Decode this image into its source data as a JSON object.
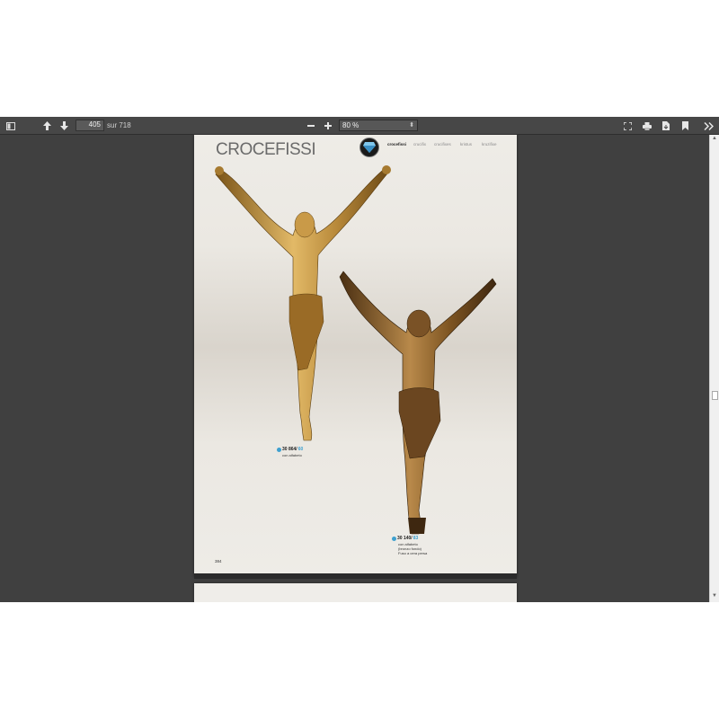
{
  "toolbar": {
    "page_number": "405",
    "page_count": "sur 718",
    "zoom_value": "80 %",
    "icons": [
      "sidebar-toggle-icon",
      "arrow-up-icon",
      "arrow-down-icon",
      "zoom-out-icon",
      "zoom-in-icon",
      "fullscreen-icon",
      "print-icon",
      "download-icon",
      "bookmark-icon",
      "double-chevron-right-icon"
    ]
  },
  "document_page": {
    "title": "CROCEFISSI",
    "categories": [
      {
        "label": "crocefissi",
        "active": true
      },
      {
        "label": "crucifix",
        "active": false
      },
      {
        "label": "crucifixes",
        "active": false
      },
      {
        "label": "kristus",
        "active": false
      },
      {
        "label": "kruzifixe",
        "active": false
      }
    ],
    "product1": {
      "code": "30 864/",
      "variant": "60",
      "note": "con alfabeto"
    },
    "product2": {
      "code": "30 140/",
      "variant": "83",
      "note1": "con alfabeto",
      "note2": "(bronzo fondo)",
      "note3": "Fuso a cera persa"
    },
    "page_number": "384"
  },
  "colors": {
    "toolbar_bg": "#474747",
    "viewer_bg": "#404040",
    "page_bg": "#eeece7",
    "badge": "#3ea0cf",
    "bronze": "#b8893a"
  }
}
